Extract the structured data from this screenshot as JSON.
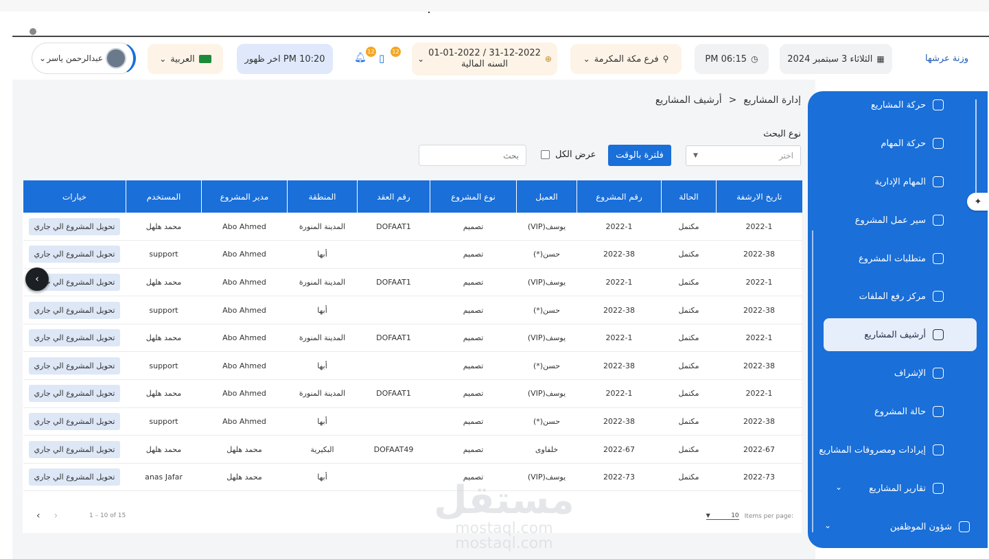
{
  "header": {
    "brand": "وزنة عرشها",
    "date": "الثلاثاء 3 سبتمبر 2024",
    "time": "PM 06:15",
    "branch": "فرع مكة المكرمة",
    "fiscal_range": "01-01-2022 / 31-12-2022",
    "fiscal_label": "السنه المالية",
    "notifications_count": "12",
    "messages_count": "12",
    "last_prayer": "اخر ظهور PM 10:20",
    "language": "العربية",
    "user_name": "عبدالرحمن ياسر"
  },
  "breadcrumb": {
    "parent": "إدارة المشاريع",
    "separator": "<",
    "current": "أرشيف المشاريع"
  },
  "filters": {
    "search_type_label": "نوع البحث",
    "select_placeholder": "اختر",
    "filter_button": "فلترة بالوقت",
    "show_all_label": "عرض الكل",
    "search_placeholder": "بحث"
  },
  "table": {
    "columns": [
      "تاريخ الارشفة",
      "الحالة",
      "رقم المشروع",
      "العميل",
      "نوع المشروع",
      "رقم العقد",
      "المنطقة",
      "مدير المشروع",
      "المستخدم",
      "خيارات"
    ],
    "rows": [
      [
        "2022-1",
        "مكتمل",
        "2022-1",
        "يوسف(VIP)",
        "تصميم",
        "DOFAAT1",
        "المدينة المنورة",
        "Abo Ahmed",
        "محمد هلهل",
        "تحويل المشروع الي جاري"
      ],
      [
        "2022-38",
        "مكتمل",
        "2022-38",
        "حسن(*)",
        "تصميم",
        "",
        "أبها",
        "Abo Ahmed",
        "support",
        "تحويل المشروع الي جاري"
      ],
      [
        "2022-1",
        "مكتمل",
        "2022-1",
        "يوسف(VIP)",
        "تصميم",
        "DOFAAT1",
        "المدينة المنورة",
        "Abo Ahmed",
        "محمد هلهل",
        "تحويل المشروع الي جاري"
      ],
      [
        "2022-38",
        "مكتمل",
        "2022-38",
        "حسن(*)",
        "تصميم",
        "",
        "أبها",
        "Abo Ahmed",
        "support",
        "تحويل المشروع الي جاري"
      ],
      [
        "2022-1",
        "مكتمل",
        "2022-1",
        "يوسف(VIP)",
        "تصميم",
        "DOFAAT1",
        "المدينة المنورة",
        "Abo Ahmed",
        "محمد هلهل",
        "تحويل المشروع الي جاري"
      ],
      [
        "2022-38",
        "مكتمل",
        "2022-38",
        "حسن(*)",
        "تصميم",
        "",
        "أبها",
        "Abo Ahmed",
        "support",
        "تحويل المشروع الي جاري"
      ],
      [
        "2022-1",
        "مكتمل",
        "2022-1",
        "يوسف(VIP)",
        "تصميم",
        "DOFAAT1",
        "المدينة المنورة",
        "Abo Ahmed",
        "محمد هلهل",
        "تحويل المشروع الي جاري"
      ],
      [
        "2022-38",
        "مكتمل",
        "2022-38",
        "حسن(*)",
        "تصميم",
        "",
        "أبها",
        "Abo Ahmed",
        "support",
        "تحويل المشروع الي جاري"
      ],
      [
        "2022-67",
        "مكتمل",
        "2022-67",
        "خلفاوى",
        "تصميم",
        "DOFAAT49",
        "البكيرية",
        "محمد هلهل",
        "محمد هلهل",
        "تحويل المشروع الي جاري"
      ],
      [
        "2022-73",
        "مكتمل",
        "2022-73",
        "يوسف(VIP)",
        "تصميم",
        "",
        "أبها",
        "محمد هلهل",
        "anas Jafar",
        "تحويل المشروع الي جاري"
      ]
    ]
  },
  "pager": {
    "range": "1 – 10 of 15",
    "items_per_page_label": "Items per page:",
    "items_per_page": "10"
  },
  "sidebar": {
    "items": [
      {
        "label": "حركة المشاريع",
        "icon": "swap-icon"
      },
      {
        "label": "حركة المهام",
        "icon": "tasks-icon"
      },
      {
        "label": "المهام الإدارية",
        "icon": "admin-tasks-icon"
      },
      {
        "label": "سير عمل المشروع",
        "icon": "workflow-icon"
      },
      {
        "label": "متطلبات المشروع",
        "icon": "requirements-icon"
      },
      {
        "label": "مركز رفع الملفات",
        "icon": "upload-icon"
      },
      {
        "label": "أرشيف المشاريع",
        "icon": "archive-icon"
      },
      {
        "label": "الإشراف",
        "icon": "supervision-icon"
      },
      {
        "label": "حالة المشروع",
        "icon": "status-icon"
      },
      {
        "label": "إيرادات ومصروفات المشاريع",
        "icon": "money-icon"
      },
      {
        "label": "تقارير المشاريع",
        "icon": "report-icon"
      },
      {
        "label": "شؤون الموظفين",
        "icon": "employees-icon"
      }
    ]
  },
  "watermark": {
    "arabic": "مستقل",
    "latin_1": "mostaql.com",
    "latin_2": "mostaql.com"
  },
  "colors": {
    "primary": "#1a6fd8",
    "badge": "#f5a623",
    "row_button": "#dde7f6"
  }
}
